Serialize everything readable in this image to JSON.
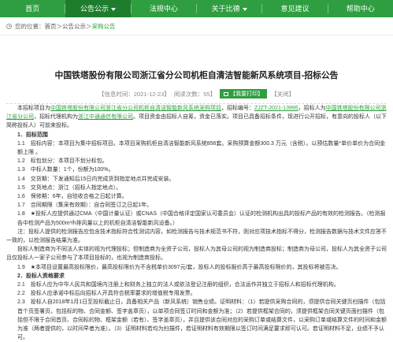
{
  "nav": {
    "items": [
      {
        "label": "首页",
        "caret": false,
        "active": false
      },
      {
        "label": "公告公示",
        "caret": true,
        "active": true
      },
      {
        "label": "法规中心",
        "caret": false,
        "active": false
      },
      {
        "label": "关于比德",
        "caret": true,
        "active": false
      },
      {
        "label": "意见建议",
        "caret": false,
        "active": false
      },
      {
        "label": "帮助中心",
        "caret": false,
        "active": false
      }
    ]
  },
  "breadcrumb": [
    "您的位置：",
    "首页",
    "＞",
    "公告公示",
    "＞",
    "采购公告"
  ],
  "title": "中国铁塔股份有限公司浙江省分公司机柜自清洁智能新风系统项目-招标公告",
  "meta": {
    "date": "【信息时间：2021-12-23】",
    "views": "阅读次数：55】",
    "font_size": "【我要打印】",
    "close": "【关闭】"
  },
  "content": {
    "intro1": "本招标项目为",
    "intro_link": "中国铁塔股份有限公司浙江省分公司机柜自清洁智能新风系统采购项目",
    "intro2": "，招标编号：",
    "intro_code": "ZJZT-2021-13995",
    "intro3": "，招标人为",
    "intro_link2": "中国铁塔股份有限公司浙江省分公司",
    "intro4": "，招标代理机构为",
    "intro_link3": "浙江中通通信有限公司",
    "intro5": "。项目资金由招标人自筹，资金已落实。项目已具备招标条件，现进行公开招标，有意向的投标人（以下简称投标人）可前来投标。",
    "sec1": "1．招标范围",
    "s1_1": "1.1　招标内容：本项目为集中招标项目。本项目采购机柜自清洁智能新风系统856套。采购预算金额300.3 万元（含税）。以预估数量*单价单价为合同金额上限 。",
    "s1_2": "1.2　标包划分：本项目不划分标包。",
    "s1_3": "1.3　中标人数量：1个，份额为100%。",
    "s1_4": "1.4　交货期：下发通知后15日内完成货到指定地点并完成安装。",
    "s1_5": "1.5　交货地点：浙江（招标人指定地点）。",
    "s1_6": "1.6　保修期：6年，自验收合格之日起计算。",
    "s1_7": "1.7　合同期限（集采有效期）：自合同签订之日起1年。",
    "s1_8": "1.8　★投标人应提供通过CMA（中国计量认证）或CNAS（中国合格评定国家认可委员会）认证的检测机构出具的投标产品的有效的检测报告。（检测报告中检测产品为500m³/h排风量以上的机柜自清洁智能新风设备。）",
    "s1_note": "注：投标人提供的检测报告应包含技术指标符合性测试内容，如检测报告与技术规范书不符，则对应项技术指标不得分，检测报告数据与技术文件应答不一致的，以检测报告结果为准。",
    "s1_note2": "投标人制造商为不同法人实体的视为代理投标；但制造商为全资子公司，投标人为其母公司的视为制造商投标；制造商为母公司，投标人为其全资子公司且仅投标人一家子公司参与了本项目投标的，也视为制造商投标。",
    "s1_9": "1.9　★本项目设置最高投标限价，最高投标限价为不含税单价3097元/套，投标人的投标报价高于最高投标限价的，其投标将被否决。",
    "sec2": "2．投标人资格要求",
    "s2_1": "2.1　投标人应为中华人民共和国境内注册上和财务上独立的法人或依法登记注册的组织，合法运作并独立于招标人和招标代理机构。",
    "s2_2": "2.2　投标人应承诺中标后向招标人开具符合税率要求的增值税专用发票。",
    "s2_3": "2.3　投标人自2018年1月1日至投标截止日，具备相关产品（新风系统）销售业绩。证明材料：（1）若提供采购合同的，须提供合同关键页扫描件（包括首个页签署页，包括标的物、合同金额、签字盖章页），以单项合同签订时间和金额为准；（2）若提供框架合同的，须提供框架合同关键页面扫描件（包括但不限于合同首页、合同标的物、框架金额（若有）、签字盖章页），并且提供该合同对应的采购订单或结算文件，以采购订单或结算文件的时间和金额为准（两者提供的，以时间早者为准）。（3）证明材料若均为扫描件，若证明材料有效期限以签订时间满足要求即可认可。若证明材料不足，业绩不予认可。"
  }
}
